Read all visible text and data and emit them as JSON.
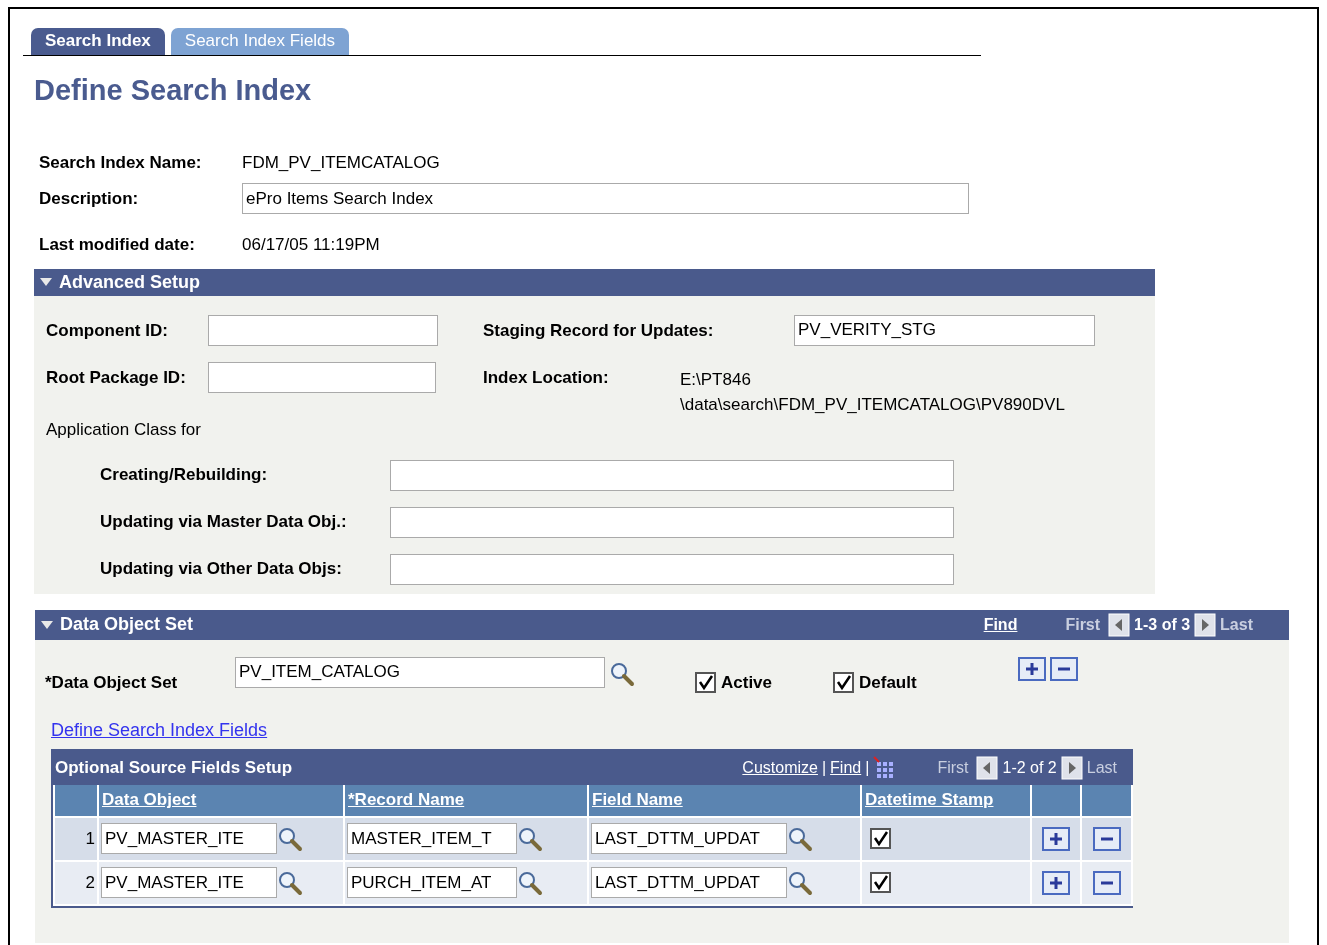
{
  "tabs": [
    {
      "label": "Search Index",
      "selected": true
    },
    {
      "label": "Search Index Fields",
      "selected": false
    }
  ],
  "page_title": "Define Search Index",
  "header_fields": [
    {
      "kind": "text",
      "label": "Search Index Name:",
      "value": "FDM_PV_ITEMCATALOG"
    },
    {
      "kind": "input",
      "label": "Description:",
      "value": "ePro Items Search Index"
    },
    {
      "kind": "text",
      "label": "Last modified date:",
      "value": "06/17/05 11:19PM"
    }
  ],
  "advanced_setup": {
    "title": "Advanced Setup",
    "expanded": true,
    "rows": [
      {
        "left": {
          "label": "Component ID:"
        },
        "right": {
          "kind": "input",
          "label": "Staging Record for Updates:",
          "value": "PV_VERITY_STG"
        }
      },
      {
        "left": {
          "label": "Root Package ID:"
        },
        "right": {
          "kind": "text",
          "label": "Index Location:",
          "value_lines": [
            "E:\\PT846",
            "\\data\\search\\FDM_PV_ITEMCATALOG\\PV890DVL"
          ]
        }
      }
    ],
    "app_class": {
      "caption": "Application Class for",
      "fields": [
        {
          "label": "Creating/Rebuilding:"
        },
        {
          "label": "Updating via Master Data Obj.:"
        },
        {
          "label": "Updating via Other Data Objs:"
        }
      ]
    }
  },
  "data_object_set": {
    "title": "Data Object Set",
    "expanded": true,
    "find": "Find",
    "nav": {
      "first": "First",
      "range": "1-3 of 3",
      "last": "Last"
    },
    "set_field": {
      "label": "*Data Object Set",
      "value": "PV_ITEM_CATALOG"
    },
    "checkboxes": [
      {
        "label": "Active",
        "checked": true
      },
      {
        "label": "Default",
        "checked": true
      }
    ],
    "link": "Define Search Index Fields",
    "grid": {
      "title": "Optional Source Fields Setup",
      "toolbar": [
        {
          "kind": "link",
          "text": "Customize"
        },
        {
          "kind": "sep",
          "text": "|"
        },
        {
          "kind": "link",
          "text": "Find"
        },
        {
          "kind": "sep",
          "text": "|"
        },
        {
          "kind": "icon"
        }
      ],
      "nav": {
        "first": "First",
        "range": "1-2 of 2",
        "last": "Last"
      },
      "columns": [
        "Data Object",
        "*Record Name",
        "Field Name",
        "Datetime Stamp"
      ],
      "rows": [
        {
          "number": "1",
          "data_object": "PV_MASTER_ITE",
          "record_name": "MASTER_ITEM_T",
          "field_name": "LAST_DTTM_UPDAT",
          "datetime_stamp": true
        },
        {
          "number": "2",
          "data_object": "PV_MASTER_ITE",
          "record_name": "PURCH_ITEM_AT",
          "field_name": "LAST_DTTM_UPDAT",
          "datetime_stamp": true
        }
      ]
    }
  }
}
